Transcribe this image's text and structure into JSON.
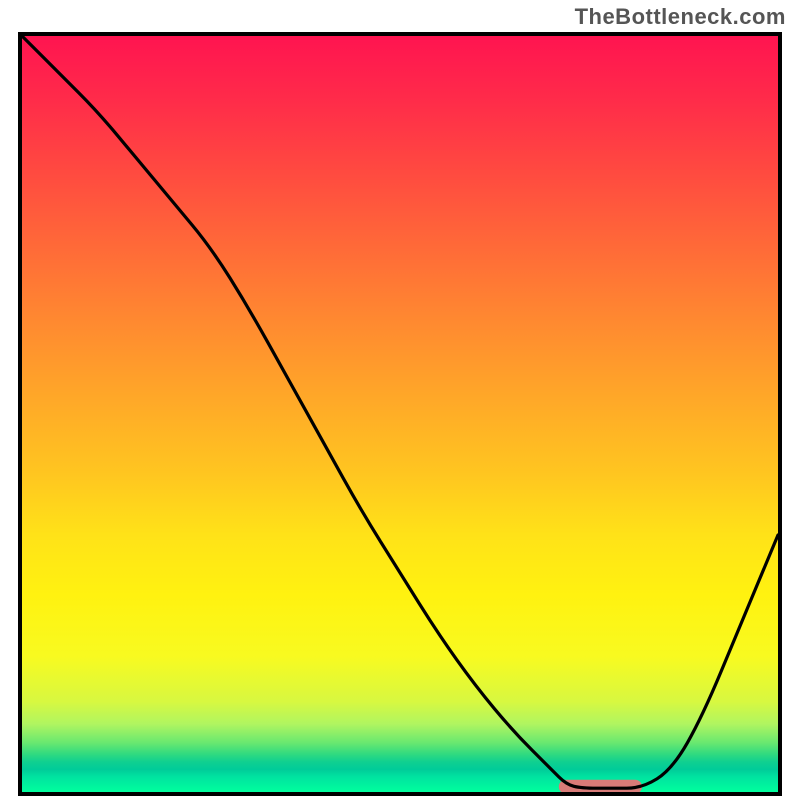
{
  "watermark": "TheBottleneck.com",
  "chart_data": {
    "type": "line",
    "title": "",
    "xlabel": "",
    "ylabel": "",
    "xlim": [
      0,
      100
    ],
    "ylim": [
      0,
      100
    ],
    "grid": false,
    "legend": false,
    "series": [
      {
        "name": "bottleneck-curve",
        "x": [
          0,
          5,
          10,
          15,
          20,
          25,
          30,
          35,
          40,
          45,
          50,
          55,
          60,
          65,
          70,
          72,
          74,
          78,
          82,
          86,
          90,
          95,
          100
        ],
        "y": [
          100,
          95,
          90,
          84,
          78,
          72,
          64,
          55,
          46,
          37,
          29,
          21,
          14,
          8,
          3,
          1,
          0.5,
          0.5,
          0.5,
          3,
          10,
          22,
          34
        ]
      }
    ],
    "annotations": [
      {
        "name": "optimal-range-marker",
        "x_start": 71,
        "x_end": 82,
        "y": 0.7,
        "shape": "rounded-bar",
        "color": "#d97b78"
      }
    ],
    "background": {
      "type": "vertical-gradient",
      "stops": [
        {
          "pos": 0.0,
          "color": "#ff1450"
        },
        {
          "pos": 0.28,
          "color": "#ff6a38"
        },
        {
          "pos": 0.58,
          "color": "#ffc620"
        },
        {
          "pos": 0.82,
          "color": "#f8fa20"
        },
        {
          "pos": 0.95,
          "color": "#30da80"
        },
        {
          "pos": 1.0,
          "color": "#00ff9d"
        }
      ]
    }
  }
}
